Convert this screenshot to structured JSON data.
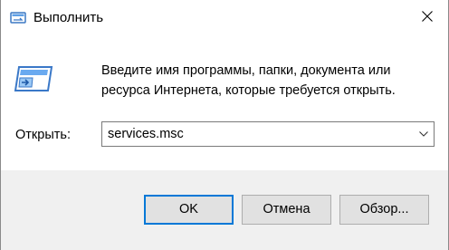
{
  "window": {
    "title": "Выполнить",
    "app_icon": "run-dialog-icon",
    "close_icon": "close-icon"
  },
  "dialog": {
    "description": "Введите имя программы, папки, документа или ресурса Интернета, которые требуется открыть.",
    "open_label": "Открыть:",
    "input_value": "services.msc",
    "dropdown_icon": "chevron-down-icon"
  },
  "buttons": {
    "ok": "OK",
    "cancel": "Отмена",
    "browse": "Обзор..."
  },
  "colors": {
    "accent": "#0078d7",
    "button_bg": "#e1e1e1",
    "footer_bg": "#f0f0f0"
  }
}
